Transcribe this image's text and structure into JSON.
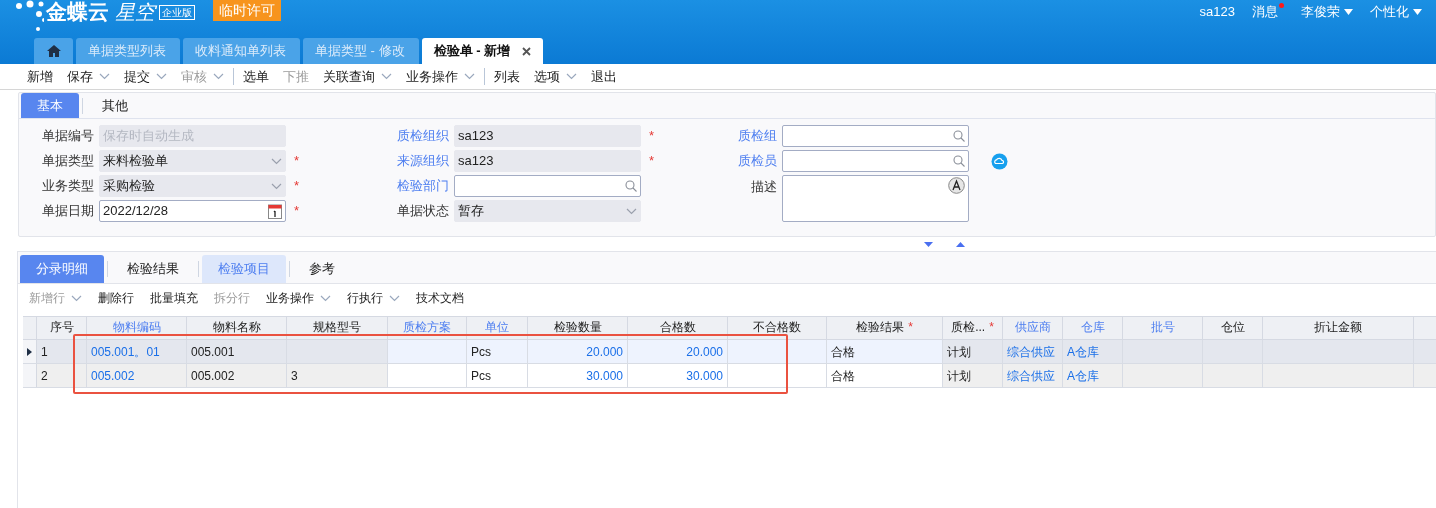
{
  "header": {
    "brand": "金蝶云",
    "product": "星空",
    "edition": "企业版",
    "license_badge": "临时许可",
    "user_items": [
      {
        "label": "sa123",
        "dropdown": false
      },
      {
        "label": "消息",
        "dropdown": false,
        "notify": true
      },
      {
        "label": "李俊荣",
        "dropdown": true
      },
      {
        "label": "个性化",
        "dropdown": true
      }
    ]
  },
  "page_tabs": [
    {
      "kind": "home",
      "selected": false
    },
    {
      "kind": "page",
      "label": "单据类型列表",
      "selected": false
    },
    {
      "kind": "page",
      "label": "收料通知单列表",
      "selected": false
    },
    {
      "kind": "page",
      "label": "单据类型 - 修改",
      "selected": false
    },
    {
      "kind": "page",
      "label": "检验单 - 新增",
      "selected": true
    }
  ],
  "toolbar": [
    {
      "kind": "button",
      "label": "新增",
      "dropdown": false,
      "disabled": false
    },
    {
      "kind": "button",
      "label": "保存",
      "dropdown": true,
      "disabled": false
    },
    {
      "kind": "button",
      "label": "提交",
      "dropdown": true,
      "disabled": false
    },
    {
      "kind": "button",
      "label": "审核",
      "dropdown": true,
      "disabled": true
    },
    {
      "kind": "separator"
    },
    {
      "kind": "button",
      "label": "选单",
      "dropdown": false,
      "disabled": false
    },
    {
      "kind": "button",
      "label": "下推",
      "dropdown": false,
      "disabled": true
    },
    {
      "kind": "button",
      "label": "关联查询",
      "dropdown": true,
      "disabled": false
    },
    {
      "kind": "button",
      "label": "业务操作",
      "dropdown": true,
      "disabled": false
    },
    {
      "kind": "separator"
    },
    {
      "kind": "button",
      "label": "列表",
      "dropdown": false,
      "disabled": false
    },
    {
      "kind": "button",
      "label": "选项",
      "dropdown": true,
      "disabled": false
    },
    {
      "kind": "button",
      "label": "退出",
      "dropdown": false,
      "disabled": false
    }
  ],
  "form_tabs": [
    {
      "label": "基本",
      "selected": true
    },
    {
      "label": "其他",
      "selected": false
    }
  ],
  "form_columns": [
    [
      {
        "label": "单据编号",
        "link": false,
        "kind": "text",
        "readonly": true,
        "placeholder": "保存时自动生成"
      },
      {
        "label": "单据类型",
        "link": false,
        "kind": "select",
        "readonly": true,
        "required_mark": "*",
        "value": "来料检验单"
      },
      {
        "label": "业务类型",
        "link": false,
        "kind": "select",
        "readonly": true,
        "required_mark": "*",
        "value": "采购检验"
      },
      {
        "label": "单据日期",
        "link": false,
        "kind": "date",
        "readonly": false,
        "required_mark": "*",
        "value": "2022/12/28"
      }
    ],
    [
      {
        "label": "质检组织",
        "link": true,
        "kind": "text",
        "readonly": true,
        "required_mark": "*",
        "value": "sa123"
      },
      {
        "label": "来源组织",
        "link": true,
        "kind": "text",
        "readonly": true,
        "required_mark": "*",
        "value": "sa123"
      },
      {
        "label": "检验部门",
        "link": true,
        "kind": "lookup",
        "readonly": false
      },
      {
        "label": "单据状态",
        "link": false,
        "kind": "select",
        "readonly": true,
        "value": "暂存"
      }
    ],
    [
      {
        "label": "质检组",
        "link": true,
        "kind": "lookup",
        "readonly": false
      },
      {
        "label": "质检员",
        "link": true,
        "kind": "lookup",
        "readonly": false,
        "side_button": true
      },
      {
        "label": "描述",
        "link": false,
        "kind": "textarea",
        "readonly": false
      }
    ]
  ],
  "entry_tabs": [
    {
      "label": "分录明细",
      "selected": true,
      "highlighted": false
    },
    {
      "label": "检验结果",
      "selected": false,
      "highlighted": false
    },
    {
      "label": "检验项目",
      "selected": false,
      "highlighted": true
    },
    {
      "label": "参考",
      "selected": false,
      "highlighted": false
    }
  ],
  "entry_toolbar": [
    {
      "label": "新增行",
      "dropdown": true,
      "disabled": true
    },
    {
      "label": "删除行",
      "dropdown": false,
      "disabled": false
    },
    {
      "label": "批量填充",
      "dropdown": false,
      "disabled": false
    },
    {
      "label": "拆分行",
      "dropdown": false,
      "disabled": true
    },
    {
      "label": "业务操作",
      "dropdown": true,
      "disabled": false
    },
    {
      "label": "行执行",
      "dropdown": true,
      "disabled": false
    },
    {
      "label": "技术文档",
      "dropdown": false,
      "disabled": false
    }
  ],
  "table": {
    "columns": [
      {
        "label": "序号",
        "link": false,
        "kind": "index"
      },
      {
        "label": "物料编码",
        "link": true,
        "kind": "text"
      },
      {
        "label": "物料名称",
        "link": false,
        "kind": "text"
      },
      {
        "label": "规格型号",
        "link": false,
        "kind": "text"
      },
      {
        "label": "质检方案",
        "link": true,
        "kind": "text"
      },
      {
        "label": "单位",
        "link": true,
        "kind": "text"
      },
      {
        "label": "检验数量",
        "link": false,
        "kind": "number"
      },
      {
        "label": "合格数",
        "link": false,
        "kind": "number"
      },
      {
        "label": "不合格数",
        "link": false,
        "kind": "number"
      },
      {
        "label": "检验结果",
        "link": false,
        "required_mark": "*",
        "kind": "text"
      },
      {
        "label": "质检...",
        "link": false,
        "required_mark": "*",
        "kind": "text"
      },
      {
        "label": "供应商",
        "link": true,
        "kind": "text"
      },
      {
        "label": "仓库",
        "link": true,
        "kind": "text"
      },
      {
        "label": "批号",
        "link": true,
        "kind": "text"
      },
      {
        "label": "仓位",
        "link": false,
        "kind": "text"
      },
      {
        "label": "折让金额",
        "link": false,
        "kind": "number"
      }
    ],
    "rows": [
      {
        "selected": true,
        "cells": [
          {
            "text": "1",
            "locked": true
          },
          {
            "text": "005.001。01",
            "locked": true,
            "link": true
          },
          {
            "text": "005.001",
            "locked": true
          },
          {
            "text": "",
            "locked": true
          },
          {
            "text": "",
            "locked": false
          },
          {
            "text": "Pcs",
            "locked": false
          },
          {
            "text": "20.000",
            "locked": false,
            "link": true
          },
          {
            "text": "20.000",
            "locked": false,
            "link": true
          },
          {
            "text": "",
            "locked": false
          },
          {
            "text": "合格",
            "locked": false
          },
          {
            "text": "计划",
            "locked": true
          },
          {
            "text": "综合供应",
            "locked": true,
            "link": true
          },
          {
            "text": "A仓库",
            "locked": true,
            "link": true
          },
          {
            "text": "",
            "locked": true
          },
          {
            "text": "",
            "locked": true
          },
          {
            "text": "",
            "locked": true
          }
        ]
      },
      {
        "selected": false,
        "cells": [
          {
            "text": "2",
            "locked": true
          },
          {
            "text": "005.002",
            "locked": true,
            "link": true
          },
          {
            "text": "005.002",
            "locked": true
          },
          {
            "text": "3",
            "locked": true
          },
          {
            "text": "",
            "locked": false
          },
          {
            "text": "Pcs",
            "locked": false
          },
          {
            "text": "30.000",
            "locked": false,
            "link": true
          },
          {
            "text": "30.000",
            "locked": false,
            "link": true
          },
          {
            "text": "",
            "locked": false
          },
          {
            "text": "合格",
            "locked": false
          },
          {
            "text": "计划",
            "locked": true
          },
          {
            "text": "综合供应",
            "locked": true,
            "link": true
          },
          {
            "text": "A仓库",
            "locked": true,
            "link": true
          },
          {
            "text": "",
            "locked": true
          },
          {
            "text": "",
            "locked": true
          },
          {
            "text": "",
            "locked": true
          }
        ]
      }
    ]
  }
}
